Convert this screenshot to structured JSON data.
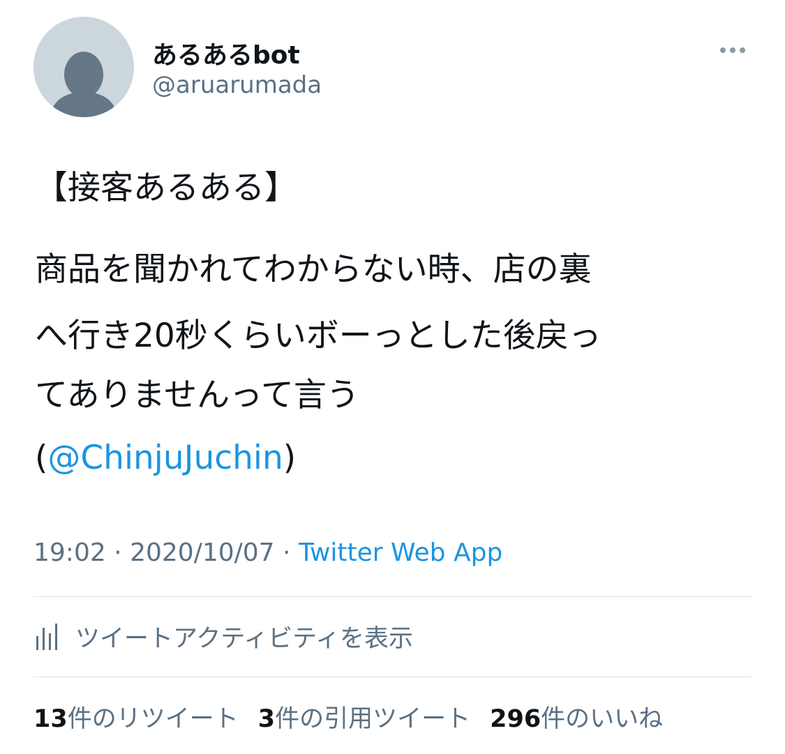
{
  "author": {
    "display_name": "あるあるbot",
    "handle": "@aruarumada",
    "avatar_icon": "default-profile-icon"
  },
  "tweet": {
    "heading": "【接客あるある】",
    "lines": [
      "商品を聞かれてわからない時、店の裏",
      "へ行き20秒くらいボーっとした後戻っ",
      "てありませんって言う"
    ],
    "mention_open": "(",
    "mention": "@ChinjuJuchin",
    "mention_close": ")"
  },
  "meta": {
    "time": "19:02",
    "separator": " · ",
    "date": "2020/10/07",
    "source": "Twitter Web App"
  },
  "activity": {
    "label": "ツイートアクティビティを表示",
    "icon": "bar-chart-icon"
  },
  "stats": {
    "retweets": {
      "count": "13",
      "label": "件のリツイート"
    },
    "quotes": {
      "count": "3",
      "label": "件の引用ツイート"
    },
    "likes": {
      "count": "296",
      "label": "件のいいね"
    }
  },
  "colors": {
    "link": "#1b95e0",
    "secondary_text": "#5b7083",
    "primary_text": "#0f1419",
    "divider": "#dfe4e8",
    "avatar_bg": "#ccd6dd",
    "avatar_fg": "#657786"
  }
}
